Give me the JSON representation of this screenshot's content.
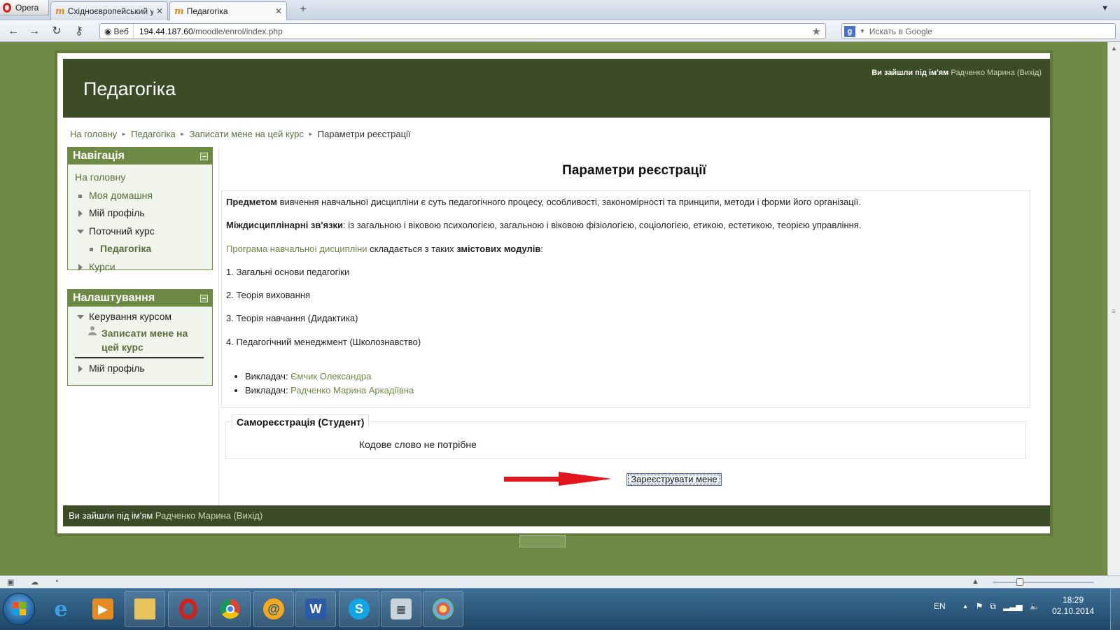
{
  "browser": {
    "menu_label": "Opera",
    "tabs": [
      {
        "title": "Східноєвропейський у...",
        "favicon": "m"
      },
      {
        "title": "Педагогіка",
        "favicon": "m"
      }
    ],
    "address": {
      "badge": "Веб",
      "host": "194.44.187.60",
      "path": "/moodle/enrol/index.php"
    },
    "search": {
      "placeholder": "Искать в Google",
      "engine_icon": "g"
    }
  },
  "site": {
    "title": "Педагогіка",
    "login_prefix": "Ви зайшли під ім'ям",
    "user_name": "Радченко Марина",
    "logout_label": "Вихід",
    "colors": {
      "header": "#3b4d26",
      "accent": "#6d8a45",
      "page_bg": "#6e8a45"
    }
  },
  "breadcrumb": {
    "items": [
      "На головну",
      "Педагогіка",
      "Записати мене на цей курс"
    ],
    "current": "Параметри реєстрації"
  },
  "navigation": {
    "title": "Навігація",
    "home": "На головну",
    "my_home": "Моя домашня",
    "my_profile": "Мій профіль",
    "current_course": "Поточний курс",
    "course_name": "Педагогіка",
    "courses": "Курси"
  },
  "settings": {
    "title": "Налаштування",
    "course_admin": "Керування курсом",
    "enrol_me_line1": "Записати мене на",
    "enrol_me_line2": "цей курс",
    "my_profile": "Мій профіль"
  },
  "main": {
    "heading": "Параметри реєстрації",
    "p1_bold": "Предмето",
    "p1_bold2": "м",
    "p1_rest": " вивчення  навчальної дисципліни є суть педагогічного процесу, особливості, закономірності та принципи, методи і форми його організації.",
    "p2_bold": "Міждисциплінарні зв'язки",
    "p2_rest": ": із загальною і віковою психологією, загальною і віковою фізіологією, соціологією, етикою, естетикою, теорією управління.",
    "p3_link": " Програма навчальної дисципліни",
    "p3_mid": " складається з таких ",
    "p3_bold": "змістових модулів",
    "p3_end": ":",
    "modules": [
      "1. Загальні основи педагогіки",
      "2. Теорія виховання",
      "3. Теорія навчання (Дидактика)",
      "4. Педагогічний менеджмент (Школознавство)"
    ],
    "teachers": [
      {
        "label": "Викладач: ",
        "name": "Ємчик Олександра"
      },
      {
        "label": "Викладач: ",
        "name": "Радченко Марина Аркадіївна"
      }
    ],
    "enrol_legend": "Самореєстрація (Студент)",
    "enrol_note": "Кодове слово не потрібне",
    "enrol_button": "Зареєструвати мене"
  },
  "footer": {
    "login_prefix": "Ви зайшли під ім'ям",
    "user_name": "Радченко Марина",
    "logout_label": "Вихід"
  },
  "taskbar": {
    "lang": "EN",
    "time": "18:29",
    "date": "02.10.2014",
    "apps": [
      "ie-icon",
      "media-player-icon",
      "explorer-icon",
      "opera-icon",
      "chrome-icon",
      "mail-agent-icon",
      "word-icon",
      "skype-icon",
      "calculator-icon",
      "paint-icon"
    ]
  }
}
